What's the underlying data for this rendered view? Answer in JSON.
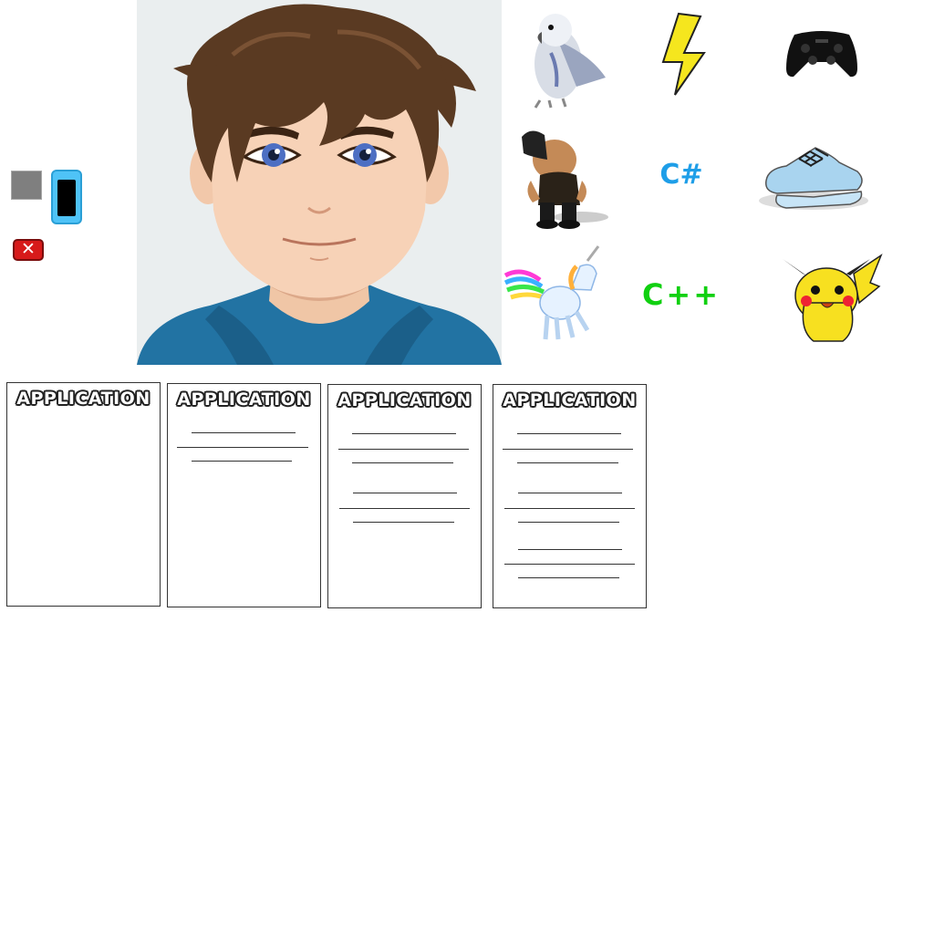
{
  "left_controls": {
    "gray_square": "gray-swatch",
    "phone": "phone-icon",
    "close": {
      "icon": "close-icon",
      "glyph": "✕",
      "color": "#d71a1a"
    }
  },
  "avatar": {
    "icon": "avatar-boy-icon",
    "hair_color": "#5a3a22",
    "hoodie_color": "#2273a3",
    "background": "#eaeeef"
  },
  "items": [
    {
      "name": "parrot",
      "icon": "parrot-icon"
    },
    {
      "name": "lightning",
      "icon": "lightning-icon",
      "color": "#f5e61e"
    },
    {
      "name": "game-controller",
      "icon": "gamepad-icon"
    },
    {
      "name": "bald-man-hat",
      "icon": "character-icon"
    },
    {
      "name": "csharp",
      "icon": "csharp-icon",
      "text": "C#",
      "color": "#1e9ee8"
    },
    {
      "name": "sneakers",
      "icon": "sneakers-icon",
      "color": "#a9d4ef"
    },
    {
      "name": "unicorn",
      "icon": "unicorn-icon"
    },
    {
      "name": "cplusplus",
      "icon": "cpp-icon",
      "text": "C++",
      "color": "#10d010"
    },
    {
      "name": "pikachu",
      "icon": "pikachu-icon",
      "color": "#f7e020"
    }
  ],
  "cards": [
    {
      "title": "APPLICATION"
    },
    {
      "title": "APPLICATION"
    },
    {
      "title": "APPLICATION"
    },
    {
      "title": "APPLICATION"
    }
  ]
}
